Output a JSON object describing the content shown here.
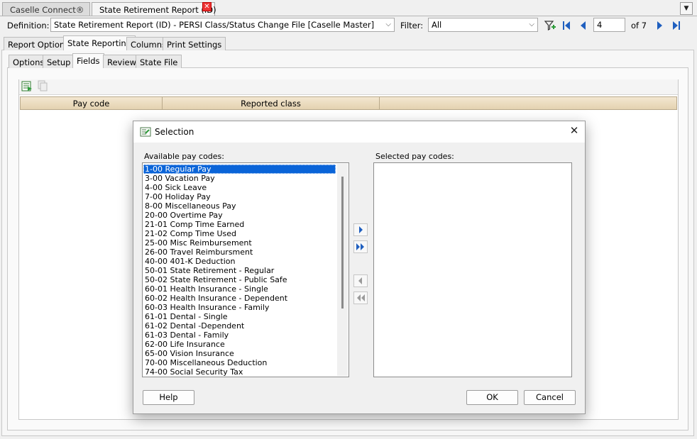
{
  "doc_tabs": [
    {
      "label": "Caselle Connect®"
    },
    {
      "label": "State Retirement Report (ID)"
    }
  ],
  "toolbar": {
    "definition_label": "Definition:",
    "definition_value": "State Retirement Report (ID) - PERSI Class/Status Change File [Caselle Master]",
    "filter_label": "Filter:",
    "filter_value": "All",
    "page_value": "4",
    "page_total": "of 7"
  },
  "main_tabs": [
    {
      "label": "Report Options"
    },
    {
      "label": "State Reporting"
    },
    {
      "label": "Columns"
    },
    {
      "label": "Print Settings"
    }
  ],
  "sub_tabs": [
    {
      "label": "Options"
    },
    {
      "label": "Setup"
    },
    {
      "label": "Fields"
    },
    {
      "label": "Review"
    },
    {
      "label": "State File"
    }
  ],
  "grid": {
    "columns": [
      "Pay code",
      "Reported class"
    ]
  },
  "dialog": {
    "title": "Selection",
    "available_label": "Available pay codes:",
    "selected_label": "Selected pay codes:",
    "available_items": [
      "1-00 Regular Pay",
      "3-00 Vacation Pay",
      "4-00 Sick Leave",
      "7-00 Holiday Pay",
      "8-00 Miscellaneous Pay",
      "20-00 Overtime Pay",
      "21-01 Comp Time Earned",
      "21-02 Comp Time Used",
      "25-00 Misc Reimbursement",
      "26-00 Travel Reimbursment",
      "40-00 401-K Deduction",
      "50-01 State Retirement - Regular",
      "50-02 State Retirement - Public Safe",
      "60-01 Health Insurance - Single",
      "60-02 Health Insurance - Dependent",
      "60-03 Health Insurance - Family",
      "61-01 Dental - Single",
      "61-02 Dental -Dependent",
      "61-03 Dental - Family",
      "62-00 Life Insurance",
      "65-00 Vision Insurance",
      "70-00 Miscellaneous Deduction",
      "74-00 Social Security Tax"
    ],
    "selected_items": [],
    "help_label": "Help",
    "ok_label": "OK",
    "cancel_label": "Cancel"
  },
  "colors": {
    "selection": "#0a64d8",
    "grid_header": "#e4d2b0",
    "nav_icon": "#1f5fbf",
    "filter_icon": "#2d9b3a"
  }
}
